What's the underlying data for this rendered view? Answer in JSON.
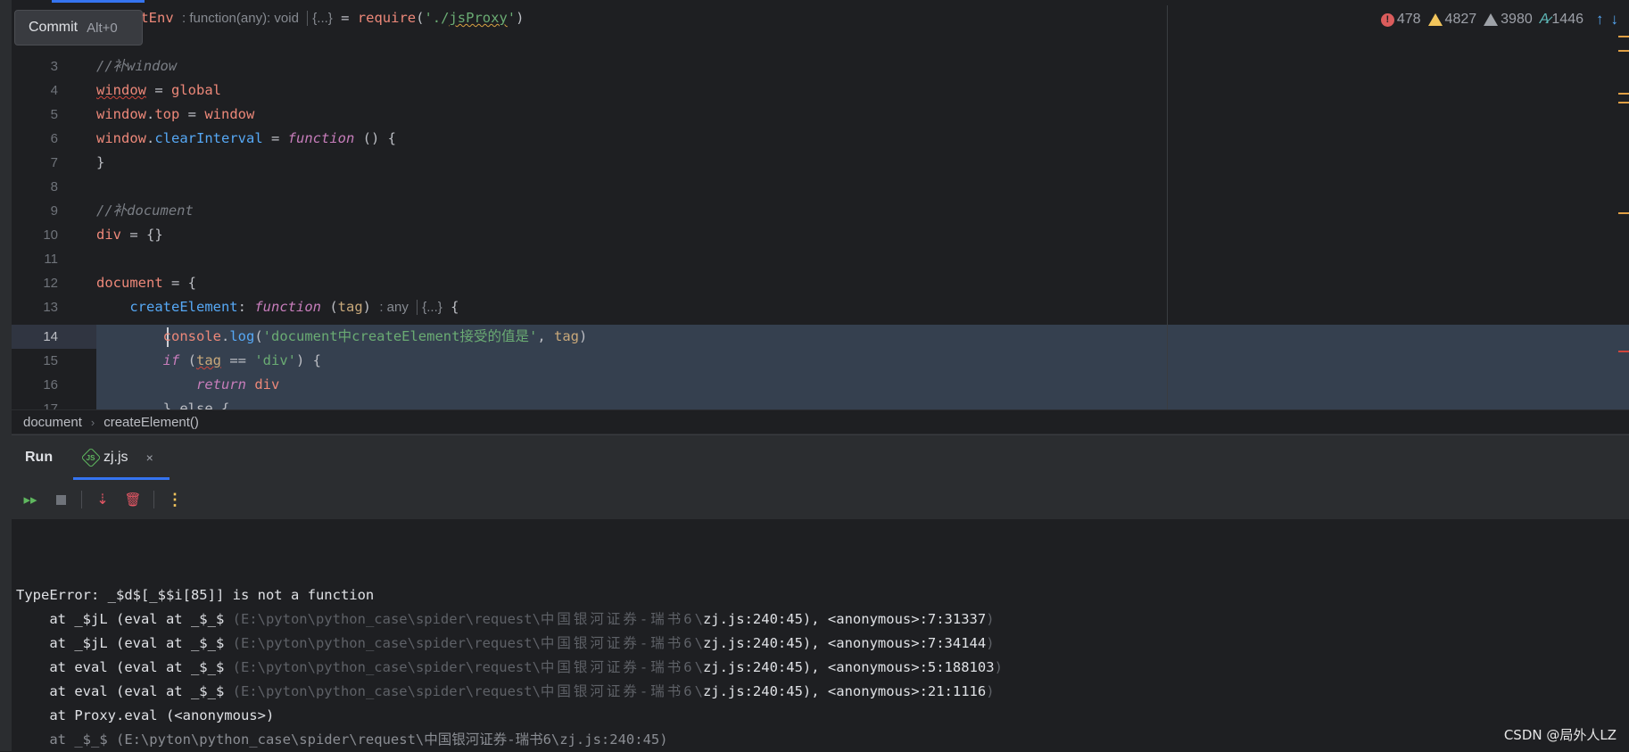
{
  "tooltip": {
    "label": "Commit",
    "shortcut": "Alt+0"
  },
  "inspections": {
    "errors": "478",
    "warnings": "4827",
    "weak_warnings": "3980",
    "typos": "1446"
  },
  "line_numbers": [
    "3",
    "4",
    "5",
    "6",
    "7",
    "8",
    "9",
    "10",
    "11",
    "12",
    "13",
    "14",
    "15",
    "16",
    "17"
  ],
  "code": {
    "l1_prefix": "etEnv",
    "l1_hint": ": function(any): void",
    "l1_fold": "{...}",
    "l1_eq": " = ",
    "l1_require": "require",
    "l1_open": "(",
    "l1_str_q1": "'./",
    "l1_str_path": "jsProxy",
    "l1_str_q2": "'",
    "l1_close": ")",
    "l3_comment": "//补window",
    "l4_window": "window",
    "l4_rest": " = ",
    "l4_global": "global",
    "l5_window": "window",
    "l5_dot": ".",
    "l5_top": "top",
    "l5_eq": " = ",
    "l5_window2": "window",
    "l6_window": "window",
    "l6_dot": ".",
    "l6_prop": "clearInterval",
    "l6_eq": " = ",
    "l6_fn": "function",
    "l6_rest": " () {",
    "l7": "}",
    "l9_comment": "//补document",
    "l10_div": "div",
    "l10_rest": " = {}",
    "l12_doc": "document",
    "l12_rest": " = {",
    "l13_indent": "    ",
    "l13_prop": "createElement",
    "l13_colon": ": ",
    "l13_fn": "function",
    "l13_open": " (",
    "l13_param": "tag",
    "l13_close": ")",
    "l13_hint": ": any",
    "l13_fold": "{...}",
    "l13_brace": " {",
    "l14_indent": "        ",
    "l14_console": "console",
    "l14_dot": ".",
    "l14_log": "log",
    "l14_open": "(",
    "l14_str": "'document中createElement接受的值是'",
    "l14_comma": ", ",
    "l14_tag": "tag",
    "l14_close": ")",
    "l15_indent": "        ",
    "l15_if": "if",
    "l15_open": " (",
    "l15_tag": "tag",
    "l15_eq": " == ",
    "l15_str": "'div'",
    "l15_close": ") {",
    "l16_indent": "            ",
    "l16_return": "return",
    "l16_div": " div",
    "l17": "        } else {"
  },
  "breadcrumb": {
    "item1": "document",
    "separator": "›",
    "item2": "createElement()"
  },
  "run": {
    "title": "Run",
    "tab_label": "zj.js",
    "tab_icon_text": "JS",
    "close": "×"
  },
  "toolbar": {
    "rerun": "▸▸",
    "scroll_end": "⇣",
    "trash": "🗑",
    "more": "⋮"
  },
  "console": {
    "error": "TypeError: _$d$[_$$i[85]] is not a function",
    "frames": [
      {
        "pre": "    at _$jL (eval at _$_$ ",
        "path": "(E:\\pyton\\python_case\\spider\\request\\",
        "cn": "中国银河证券-瑞书6",
        "sep": "\\",
        "file": "zj.js:240:45), <anonymous>:7:31337",
        "end": ")"
      },
      {
        "pre": "    at _$jL (eval at _$_$ ",
        "path": "(E:\\pyton\\python_case\\spider\\request\\",
        "cn": "中国银河证券-瑞书6",
        "sep": "\\",
        "file": "zj.js:240:45), <anonymous>:7:34144",
        "end": ")"
      },
      {
        "pre": "    at eval (eval at _$_$ ",
        "path": "(E:\\pyton\\python_case\\spider\\request\\",
        "cn": "中国银河证券-瑞书6",
        "sep": "\\",
        "file": "zj.js:240:45), <anonymous>:5:188103",
        "end": ")"
      },
      {
        "pre": "    at eval (eval at _$_$ ",
        "path": "(E:\\pyton\\python_case\\spider\\request\\",
        "cn": "中国银河证券-瑞书6",
        "sep": "\\",
        "file": "zj.js:240:45), <anonymous>:21:1116",
        "end": ")"
      }
    ],
    "proxy_line": "    at Proxy.eval (<anonymous>)",
    "partial_line": "    at _$_$ (E:\\pyton\\python_case\\spider\\request\\中国银河证券-瑞书6\\zj.js:240:45)"
  },
  "watermark": "CSDN @局外人LZ"
}
